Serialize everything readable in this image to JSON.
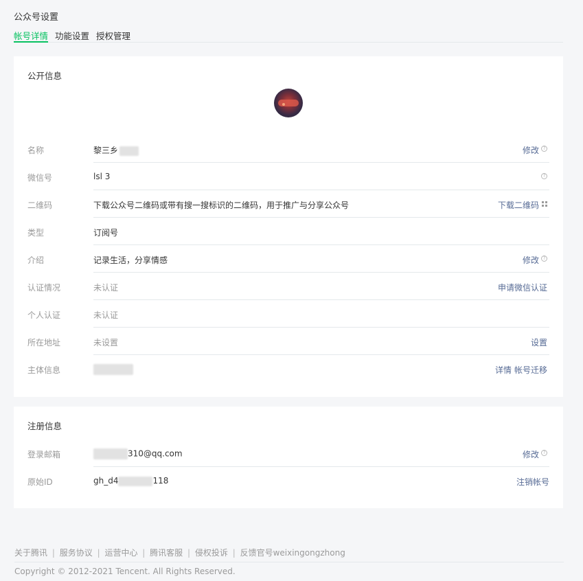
{
  "page_title": "公众号设置",
  "tabs": [
    {
      "label": "帐号详情",
      "active": true
    },
    {
      "label": "功能设置",
      "active": false
    },
    {
      "label": "授权管理",
      "active": false
    }
  ],
  "public_info": {
    "title": "公开信息",
    "rows": [
      {
        "label": "名称",
        "value": "黎三乡",
        "action": "修改",
        "icon": "help-icon"
      },
      {
        "label": "微信号",
        "value": "lsl   3",
        "action": "",
        "icon": "help-icon"
      },
      {
        "label": "二维码",
        "value": "下载公众号二维码或带有搜一搜标识的二维码，用于推广与分享公众号",
        "action": "下载二维码",
        "icon": "qr-icon"
      },
      {
        "label": "类型",
        "value": "订阅号",
        "action": ""
      },
      {
        "label": "介绍",
        "value": "记录生活，分享情感",
        "action": "修改",
        "icon": "help-icon"
      },
      {
        "label": "认证情况",
        "value": "未认证",
        "action": "申请微信认证"
      },
      {
        "label": "个人认证",
        "value": "未认证",
        "action": ""
      },
      {
        "label": "所在地址",
        "value": "未设置",
        "action": "设置"
      },
      {
        "label": "主体信息",
        "value": "",
        "action_1": "详情",
        "action_2": "帐号迁移"
      }
    ]
  },
  "register_info": {
    "title": "注册信息",
    "rows": [
      {
        "label": "登录邮箱",
        "value": "310@qq.com",
        "action": "修改",
        "icon": "help-icon"
      },
      {
        "label": "原始ID",
        "value_prefix": "gh_d4",
        "value_suffix": "118",
        "action": "注销帐号"
      }
    ]
  },
  "footer": {
    "links": [
      "关于腾讯",
      "服务协议",
      "运营中心",
      "腾讯客服",
      "侵权投诉",
      "反馈官号weixingongzhong"
    ],
    "separator": "|",
    "copyright": "Copyright © 2012-2021 Tencent. All Rights Reserved."
  },
  "colors": {
    "accent": "#07c160",
    "link": "#576b95",
    "muted": "#9a9a9a",
    "background": "#f5f6f8",
    "card": "#ffffff"
  }
}
